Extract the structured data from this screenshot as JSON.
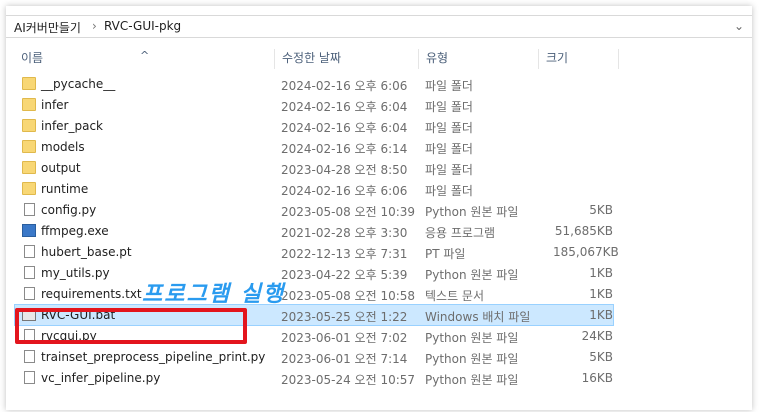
{
  "breadcrumb": [
    "AI커버만들기",
    "RVC-GUI-pkg"
  ],
  "columns": {
    "name": "이름",
    "date": "수정한 날짜",
    "type": "유형",
    "size": "크기"
  },
  "files": [
    {
      "name": "__pycache__",
      "date": "2024-02-16 오후 6:06",
      "type": "파일 폴더",
      "size": "",
      "icon": "folder"
    },
    {
      "name": "infer",
      "date": "2024-02-16 오후 6:04",
      "type": "파일 폴더",
      "size": "",
      "icon": "folder"
    },
    {
      "name": "infer_pack",
      "date": "2024-02-16 오후 6:04",
      "type": "파일 폴더",
      "size": "",
      "icon": "folder"
    },
    {
      "name": "models",
      "date": "2024-02-16 오후 6:14",
      "type": "파일 폴더",
      "size": "",
      "icon": "folder"
    },
    {
      "name": "output",
      "date": "2023-04-28 오전 8:50",
      "type": "파일 폴더",
      "size": "",
      "icon": "folder"
    },
    {
      "name": "runtime",
      "date": "2024-02-16 오후 6:06",
      "type": "파일 폴더",
      "size": "",
      "icon": "folder"
    },
    {
      "name": "config.py",
      "date": "2023-05-08 오전 10:39",
      "type": "Python 원본 파일",
      "size": "5KB",
      "icon": "file"
    },
    {
      "name": "ffmpeg.exe",
      "date": "2021-02-28 오후 3:30",
      "type": "응용 프로그램",
      "size": "51,685KB",
      "icon": "exe"
    },
    {
      "name": "hubert_base.pt",
      "date": "2022-12-13 오후 7:31",
      "type": "PT 파일",
      "size": "185,067KB",
      "icon": "file"
    },
    {
      "name": "my_utils.py",
      "date": "2023-04-22 오후 5:39",
      "type": "Python 원본 파일",
      "size": "1KB",
      "icon": "file"
    },
    {
      "name": "requirements.txt",
      "date": "2023-05-08 오전 10:58",
      "type": "텍스트 문서",
      "size": "1KB",
      "icon": "file"
    },
    {
      "name": "RVC-GUI.bat",
      "date": "2023-05-25 오전 1:22",
      "type": "Windows 배치 파일",
      "size": "1KB",
      "icon": "bat",
      "selected": true
    },
    {
      "name": "rvcgui.py",
      "date": "2023-06-01 오전 7:02",
      "type": "Python 원본 파일",
      "size": "24KB",
      "icon": "file"
    },
    {
      "name": "trainset_preprocess_pipeline_print.py",
      "date": "2023-06-01 오전 7:14",
      "type": "Python 원본 파일",
      "size": "5KB",
      "icon": "file"
    },
    {
      "name": "vc_infer_pipeline.py",
      "date": "2023-05-24 오전 10:57",
      "type": "Python 원본 파일",
      "size": "16KB",
      "icon": "file"
    }
  ],
  "annotation": "프로그램 실행"
}
